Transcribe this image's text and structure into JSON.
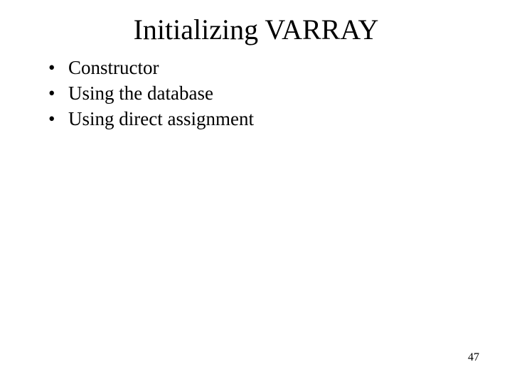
{
  "slide": {
    "title": "Initializing VARRAY",
    "bullets": [
      "Constructor",
      "Using the database",
      "Using direct assignment"
    ],
    "page_number": "47"
  }
}
